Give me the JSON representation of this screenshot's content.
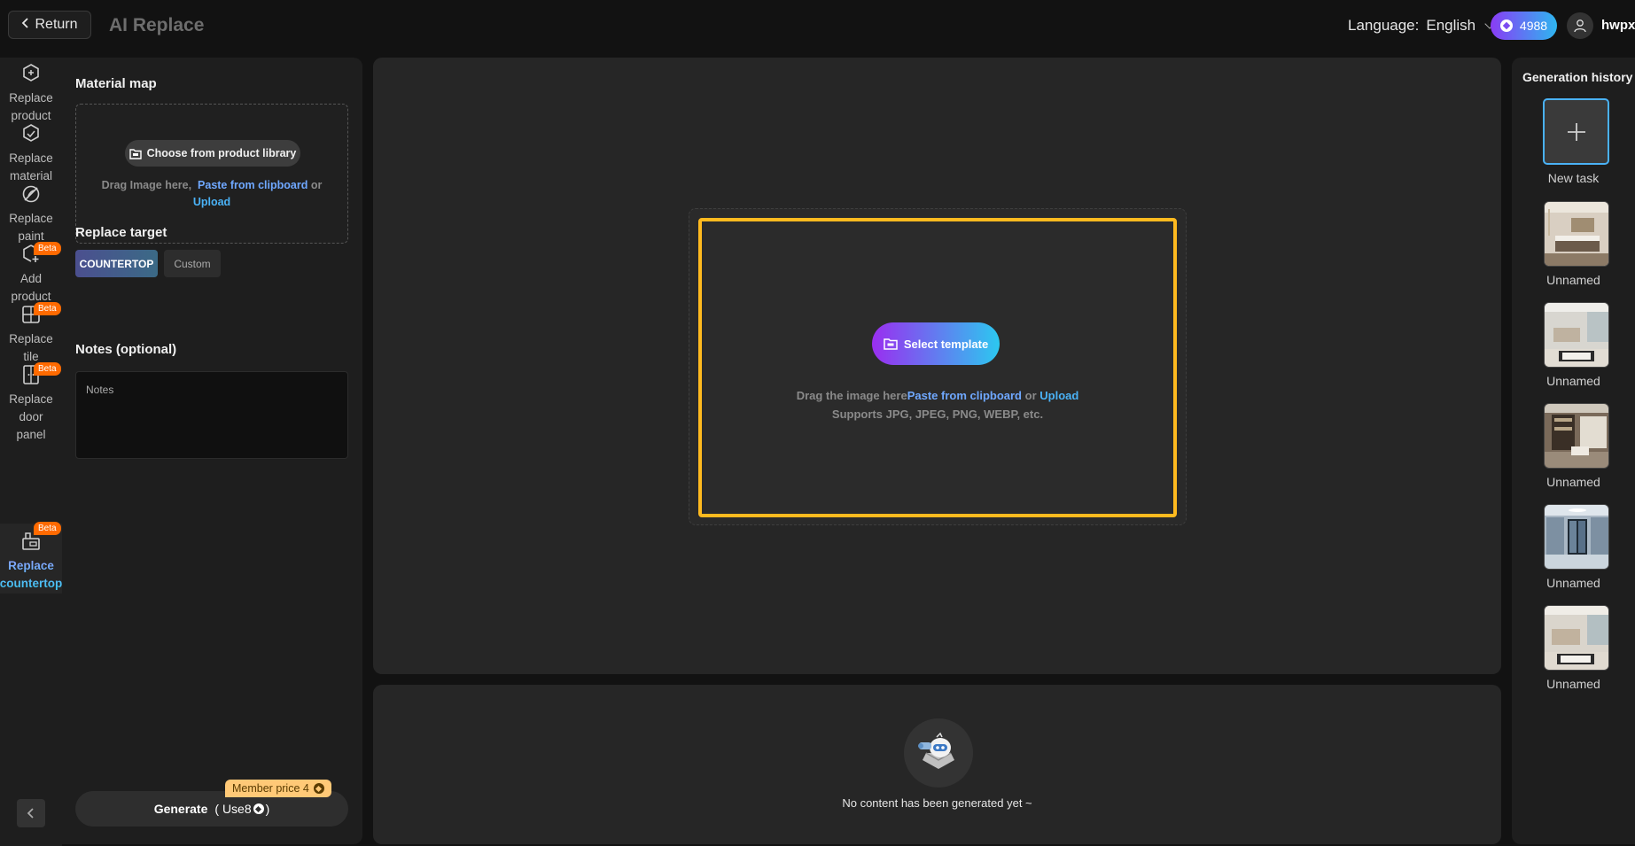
{
  "header": {
    "return_label": "Return",
    "title": "AI Replace",
    "language_label": "Language:",
    "language_value": "English",
    "credits": "4988",
    "username": "hwpx"
  },
  "tools": [
    {
      "label_1": "Replace",
      "label_2": "product",
      "beta": false
    },
    {
      "label_1": "Replace",
      "label_2": "material",
      "beta": false
    },
    {
      "label_1": "Replace",
      "label_2": "paint",
      "beta": false
    },
    {
      "label_1": "Add",
      "label_2": "product",
      "beta": true
    },
    {
      "label_1": "Replace",
      "label_2": "tile",
      "beta": true
    },
    {
      "label_1": "Replace",
      "label_2": "door",
      "label_3": "panel",
      "beta": true
    },
    {
      "label_1": "Replace",
      "label_2": "countertop",
      "beta": true,
      "active": true
    }
  ],
  "beta_label": "Beta",
  "panel": {
    "material_map_title": "Material map",
    "product_library_button": "Choose from product library",
    "drag_text": "Drag Image here,",
    "paste_link": "Paste from clipboard",
    "or_text": "or",
    "upload_link": "Upload",
    "replace_target_title": "Replace target",
    "target_selected": "COUNTERTOP",
    "target_custom": "Custom",
    "notes_title": "Notes (optional)",
    "notes_placeholder": "Notes",
    "member_price": "Member price 4",
    "generate_label": "Generate",
    "use_cost": "( Use8",
    "use_cost_close": ")"
  },
  "canvas": {
    "select_template": "Select template",
    "drag_text": "Drag the image here",
    "paste_link": "Paste from clipboard",
    "or_text": "or",
    "upload_link": "Upload",
    "supports": "Supports JPG, JPEG, PNG, WEBP, etc."
  },
  "results": {
    "empty_text": "No content has been generated yet ~"
  },
  "history": {
    "title": "Generation history",
    "new_task": "New task",
    "items": [
      {
        "label": "Unnamed"
      },
      {
        "label": "Unnamed"
      },
      {
        "label": "Unnamed"
      },
      {
        "label": "Unnamed"
      },
      {
        "label": "Unnamed"
      }
    ]
  },
  "colors": {
    "accent_blue": "#4ab2f6",
    "highlight_border": "#ffba1f",
    "beta_orange": "#ff6a00",
    "member_gold": "#ffc977"
  }
}
